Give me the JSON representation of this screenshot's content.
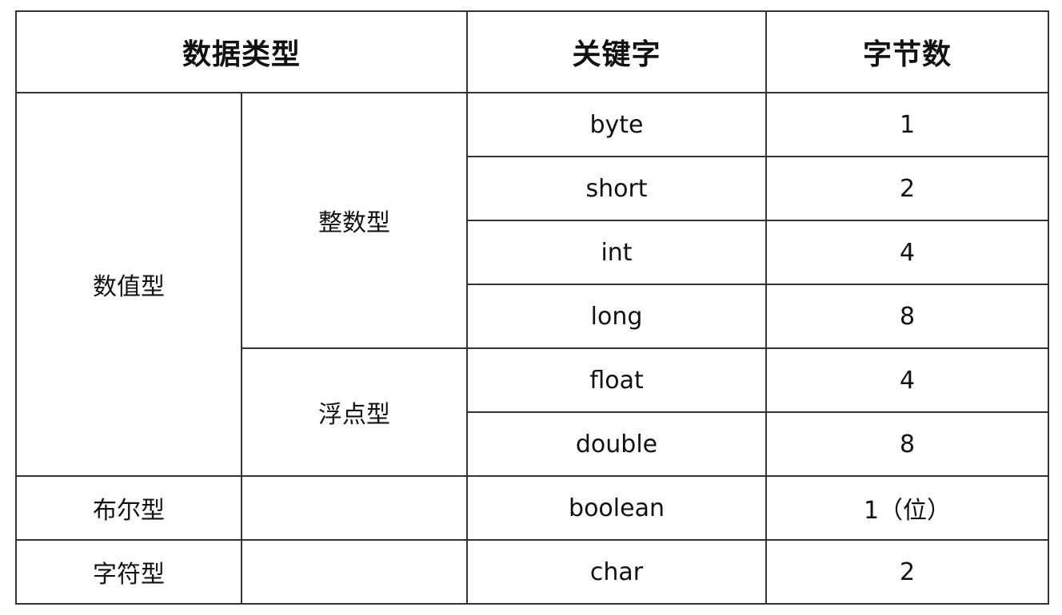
{
  "table": {
    "headers": {
      "data_type": "数据类型",
      "keyword": "关键字",
      "bytes": "字节数"
    },
    "groups": {
      "numeric": "数值型",
      "integer": "整数型",
      "floating": "浮点型",
      "boolean": "布尔型",
      "character": "字符型"
    },
    "rows": [
      {
        "keyword": "byte",
        "bytes": "1"
      },
      {
        "keyword": "short",
        "bytes": "2"
      },
      {
        "keyword": "int",
        "bytes": "4"
      },
      {
        "keyword": "long",
        "bytes": "8"
      },
      {
        "keyword": "float",
        "bytes": "4"
      },
      {
        "keyword": "double",
        "bytes": "8"
      },
      {
        "keyword": "boolean",
        "bytes": "1（位）"
      },
      {
        "keyword": "char",
        "bytes": "2"
      }
    ]
  }
}
